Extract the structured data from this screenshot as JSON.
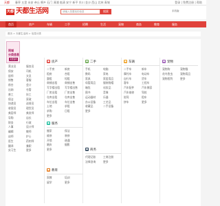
{
  "topbar": {
    "city": "天都",
    "cities": "春亭 五里 永安 帝丘 桐乡 石门 漳浦 临清 安宁 新平 东川 金沙 西山 北林 青城",
    "login": "登录 | 免费注册 | 帮助"
  },
  "header": {
    "logo_badge": "天都",
    "logo_text": "天都生活网",
    "search_placeholder": "请输入您要找的信息",
    "search_button": "搜索",
    "phone": "手机版"
  },
  "nav": [
    "首页",
    "房产",
    "车辆",
    "二手",
    "招聘",
    "生活",
    "宠物",
    "商务",
    "教育",
    "服务",
    "供求信息"
  ],
  "breadcrumb": "首页 > 天都生活网 > 信息分类",
  "banner": {
    "line1": "同城",
    "line2": "分类信息",
    "button": "免费发布"
  },
  "categories": [
    {
      "title": "招聘",
      "color": "#2f7ed8",
      "items": [
        "营业员",
        "服务员",
        "保安",
        "司机",
        "厨师",
        "文员",
        "销售",
        "客服",
        "前台",
        "会计",
        "出纳",
        "仓管",
        "普工",
        "技工",
        "保洁",
        "家政",
        "快递员",
        "送餐员",
        "收银员",
        "理货员",
        "美容师",
        "美发师",
        "导购",
        "店长",
        "财务",
        "行政",
        "人事",
        "设计师",
        "编辑",
        "教师",
        "幼师",
        "护士",
        "医生",
        "药剂师",
        "翻译",
        "兼职",
        "实习生",
        "更多"
      ]
    },
    {
      "title": "房产",
      "color": "#e0413a",
      "items": [
        "二手房",
        "新房",
        "租房",
        "合租",
        "整租",
        "短租",
        "商铺出租",
        "商铺出售",
        "写字楼出租",
        "写字楼出售",
        "厂房出租",
        "厂房出售",
        "仓库出租",
        "仓库出售",
        "车位出租",
        "车位出售",
        "土地",
        "求租",
        "求购",
        "日租",
        "更多"
      ]
    },
    {
      "title": "二手",
      "color": "#6aa84f",
      "items": [
        "手机",
        "电脑",
        "数码",
        "家电",
        "家具",
        "家居用品",
        "母婴用品",
        "服装鞋帽",
        "箱包",
        "化妆品",
        "图书",
        "音像",
        "运动器材",
        "乐器",
        "办公设备",
        "工艺品",
        "收藏品",
        "二手设备",
        "更多"
      ]
    },
    {
      "title": "车辆",
      "color": "#f0a020",
      "items": [
        "二手车",
        "新车",
        "摩托车",
        "电动车",
        "自行车",
        "货车",
        "客车",
        "工程车",
        "汽车配件",
        "汽车美容",
        "汽车维修",
        "驾校",
        "陪驾",
        "租车",
        "拼车",
        "更多"
      ]
    },
    {
      "title": "宠物",
      "color": "#9b59b6",
      "items": [
        "宠物狗",
        "宠物猫",
        "花鸟鱼虫",
        "宠物用品",
        "宠物医院",
        "更多"
      ]
    },
    {
      "title": "服务",
      "color": "#1abc9c",
      "items": [
        "搬家",
        "保洁",
        "维修",
        "装修",
        "开锁",
        "疏通",
        "婚庆",
        "摄影",
        "更多"
      ]
    },
    {
      "title": "商务",
      "color": "#34495e",
      "items": [
        "代理记账",
        "工商注册",
        "法律咨询",
        "更多"
      ]
    },
    {
      "title": "教育",
      "color": "#e67e22",
      "items": [
        "家教",
        "培训",
        "留学",
        "更多"
      ]
    }
  ]
}
